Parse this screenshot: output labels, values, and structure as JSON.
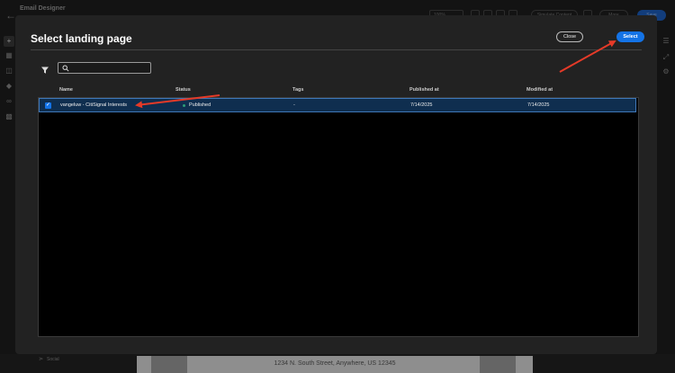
{
  "app": {
    "title": "Email Designer",
    "zoom": "100%",
    "simulate_label": "Simulate Content",
    "more_label": "More",
    "save_label": "Save"
  },
  "modal": {
    "title": "Select landing page",
    "close_label": "Close",
    "select_label": "Select",
    "search_placeholder": ""
  },
  "table": {
    "columns": [
      "Name",
      "Status",
      "Tags",
      "Published at",
      "Modified at"
    ],
    "rows": [
      {
        "selected": true,
        "name": "vangeluw - CitiSignal Interests",
        "status": "Published",
        "tags": "-",
        "published_at": "7/14/2025",
        "modified_at": "7/14/2025"
      }
    ]
  },
  "footer": {
    "social_label": "Social",
    "address": "1234 N. South Street, Anywhere, US 12345"
  },
  "colors": {
    "accent": "#1473e6",
    "selected_row": "#0f2e4f",
    "published_dot": "#2d9d78",
    "arrow": "#e53a28"
  }
}
